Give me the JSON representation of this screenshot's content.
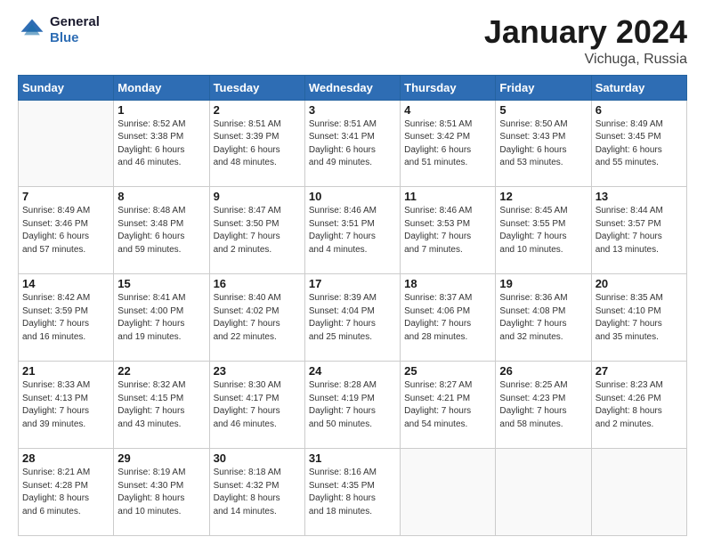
{
  "logo": {
    "line1": "General",
    "line2": "Blue"
  },
  "title": "January 2024",
  "subtitle": "Vichuga, Russia",
  "days_header": [
    "Sunday",
    "Monday",
    "Tuesday",
    "Wednesday",
    "Thursday",
    "Friday",
    "Saturday"
  ],
  "weeks": [
    [
      {
        "day": "",
        "info": ""
      },
      {
        "day": "1",
        "info": "Sunrise: 8:52 AM\nSunset: 3:38 PM\nDaylight: 6 hours\nand 46 minutes."
      },
      {
        "day": "2",
        "info": "Sunrise: 8:51 AM\nSunset: 3:39 PM\nDaylight: 6 hours\nand 48 minutes."
      },
      {
        "day": "3",
        "info": "Sunrise: 8:51 AM\nSunset: 3:41 PM\nDaylight: 6 hours\nand 49 minutes."
      },
      {
        "day": "4",
        "info": "Sunrise: 8:51 AM\nSunset: 3:42 PM\nDaylight: 6 hours\nand 51 minutes."
      },
      {
        "day": "5",
        "info": "Sunrise: 8:50 AM\nSunset: 3:43 PM\nDaylight: 6 hours\nand 53 minutes."
      },
      {
        "day": "6",
        "info": "Sunrise: 8:49 AM\nSunset: 3:45 PM\nDaylight: 6 hours\nand 55 minutes."
      }
    ],
    [
      {
        "day": "7",
        "info": "Sunrise: 8:49 AM\nSunset: 3:46 PM\nDaylight: 6 hours\nand 57 minutes."
      },
      {
        "day": "8",
        "info": "Sunrise: 8:48 AM\nSunset: 3:48 PM\nDaylight: 6 hours\nand 59 minutes."
      },
      {
        "day": "9",
        "info": "Sunrise: 8:47 AM\nSunset: 3:50 PM\nDaylight: 7 hours\nand 2 minutes."
      },
      {
        "day": "10",
        "info": "Sunrise: 8:46 AM\nSunset: 3:51 PM\nDaylight: 7 hours\nand 4 minutes."
      },
      {
        "day": "11",
        "info": "Sunrise: 8:46 AM\nSunset: 3:53 PM\nDaylight: 7 hours\nand 7 minutes."
      },
      {
        "day": "12",
        "info": "Sunrise: 8:45 AM\nSunset: 3:55 PM\nDaylight: 7 hours\nand 10 minutes."
      },
      {
        "day": "13",
        "info": "Sunrise: 8:44 AM\nSunset: 3:57 PM\nDaylight: 7 hours\nand 13 minutes."
      }
    ],
    [
      {
        "day": "14",
        "info": "Sunrise: 8:42 AM\nSunset: 3:59 PM\nDaylight: 7 hours\nand 16 minutes."
      },
      {
        "day": "15",
        "info": "Sunrise: 8:41 AM\nSunset: 4:00 PM\nDaylight: 7 hours\nand 19 minutes."
      },
      {
        "day": "16",
        "info": "Sunrise: 8:40 AM\nSunset: 4:02 PM\nDaylight: 7 hours\nand 22 minutes."
      },
      {
        "day": "17",
        "info": "Sunrise: 8:39 AM\nSunset: 4:04 PM\nDaylight: 7 hours\nand 25 minutes."
      },
      {
        "day": "18",
        "info": "Sunrise: 8:37 AM\nSunset: 4:06 PM\nDaylight: 7 hours\nand 28 minutes."
      },
      {
        "day": "19",
        "info": "Sunrise: 8:36 AM\nSunset: 4:08 PM\nDaylight: 7 hours\nand 32 minutes."
      },
      {
        "day": "20",
        "info": "Sunrise: 8:35 AM\nSunset: 4:10 PM\nDaylight: 7 hours\nand 35 minutes."
      }
    ],
    [
      {
        "day": "21",
        "info": "Sunrise: 8:33 AM\nSunset: 4:13 PM\nDaylight: 7 hours\nand 39 minutes."
      },
      {
        "day": "22",
        "info": "Sunrise: 8:32 AM\nSunset: 4:15 PM\nDaylight: 7 hours\nand 43 minutes."
      },
      {
        "day": "23",
        "info": "Sunrise: 8:30 AM\nSunset: 4:17 PM\nDaylight: 7 hours\nand 46 minutes."
      },
      {
        "day": "24",
        "info": "Sunrise: 8:28 AM\nSunset: 4:19 PM\nDaylight: 7 hours\nand 50 minutes."
      },
      {
        "day": "25",
        "info": "Sunrise: 8:27 AM\nSunset: 4:21 PM\nDaylight: 7 hours\nand 54 minutes."
      },
      {
        "day": "26",
        "info": "Sunrise: 8:25 AM\nSunset: 4:23 PM\nDaylight: 7 hours\nand 58 minutes."
      },
      {
        "day": "27",
        "info": "Sunrise: 8:23 AM\nSunset: 4:26 PM\nDaylight: 8 hours\nand 2 minutes."
      }
    ],
    [
      {
        "day": "28",
        "info": "Sunrise: 8:21 AM\nSunset: 4:28 PM\nDaylight: 8 hours\nand 6 minutes."
      },
      {
        "day": "29",
        "info": "Sunrise: 8:19 AM\nSunset: 4:30 PM\nDaylight: 8 hours\nand 10 minutes."
      },
      {
        "day": "30",
        "info": "Sunrise: 8:18 AM\nSunset: 4:32 PM\nDaylight: 8 hours\nand 14 minutes."
      },
      {
        "day": "31",
        "info": "Sunrise: 8:16 AM\nSunset: 4:35 PM\nDaylight: 8 hours\nand 18 minutes."
      },
      {
        "day": "",
        "info": ""
      },
      {
        "day": "",
        "info": ""
      },
      {
        "day": "",
        "info": ""
      }
    ]
  ]
}
